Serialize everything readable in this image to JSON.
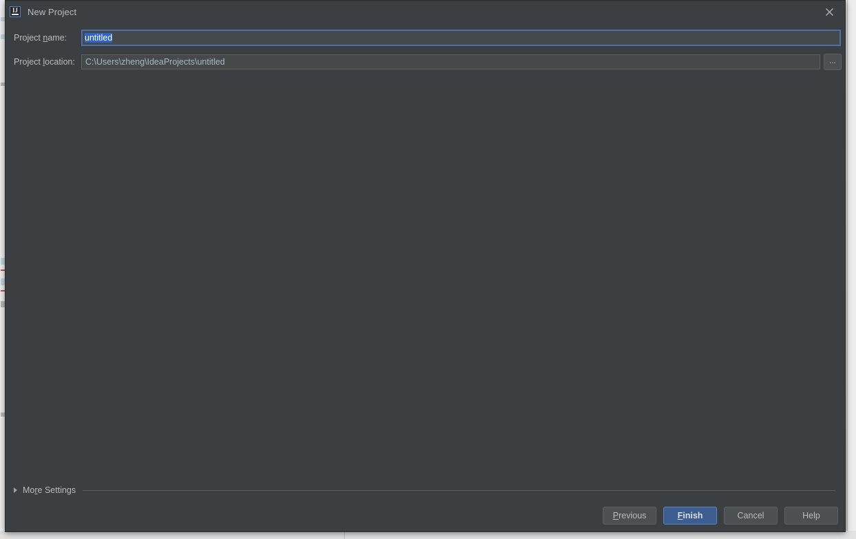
{
  "window": {
    "title": "New Project",
    "app_icon": "intellij-idea-icon",
    "close_icon": "close-icon"
  },
  "form": {
    "project_name": {
      "label_prefix": "Project ",
      "label_mnemonic": "n",
      "label_suffix": "ame:",
      "label_full": "Project name:",
      "value": "untitled",
      "selected": true
    },
    "project_location": {
      "label_prefix": "Project ",
      "label_mnemonic": "l",
      "label_suffix": "ocation:",
      "label_full": "Project location:",
      "value": "C:\\Users\\zheng\\IdeaProjects\\untitled"
    },
    "browse_button": {
      "label": "...",
      "icon": "ellipsis-icon"
    }
  },
  "more_settings": {
    "label_prefix": "Mo",
    "label_mnemonic": "r",
    "label_suffix": "e Settings",
    "label_full": "More Settings",
    "expanded": false,
    "arrow_icon": "chevron-right-icon"
  },
  "buttons": {
    "previous": {
      "mnemonic": "P",
      "rest": "revious",
      "label_full": "Previous"
    },
    "finish": {
      "mnemonic": "F",
      "rest": "inish",
      "label_full": "Finish",
      "is_default": true
    },
    "cancel": {
      "label_full": "Cancel"
    },
    "help": {
      "label_full": "Help"
    }
  },
  "colors": {
    "dialog_background": "#3c3f41",
    "field_background": "#45494a",
    "focus_border": "#4b6eaf",
    "text": "#bbbbbb",
    "path_text": "#a9b7c6",
    "selection": "#2f65ca",
    "default_button": "#3c5d8f",
    "button_background": "#4c5052"
  }
}
